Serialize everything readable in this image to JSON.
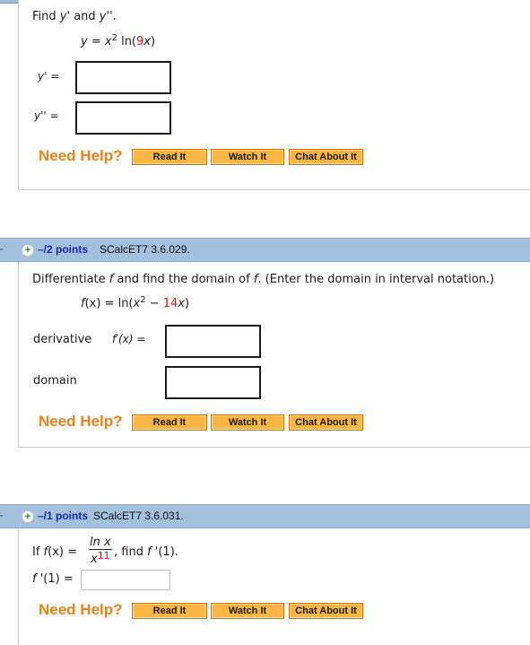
{
  "q1": {
    "prompt_prefix": "Find ",
    "prompt_y1": "y'",
    "prompt_and": " and ",
    "prompt_y2": "y''",
    "prompt_suffix": ".",
    "eq_lhs": "y",
    "eq_eq": " = ",
    "eq_x": "x",
    "eq_exp": "2",
    "eq_ln": " ln(",
    "eq_coef": "9",
    "eq_var": "x",
    "eq_close": ")",
    "label_y1_var": "y'",
    "label_y1_eq": " =",
    "label_y2_var": "y''",
    "label_y2_eq": " =",
    "answer_y1": "",
    "answer_y2": ""
  },
  "q2": {
    "points": "–/2 points",
    "reference": "SCalcET7 3.6.029.",
    "prompt_a": "Differentiate ",
    "prompt_f1": "f",
    "prompt_b": " and find the domain of ",
    "prompt_f2": "f",
    "prompt_c": ". (Enter the domain in interval notation.)",
    "eq_f": "f",
    "eq_paren": "(x)",
    "eq_eq": " = ln(",
    "eq_x": "x",
    "eq_exp": "2",
    "eq_minus": " − ",
    "eq_coef": "14",
    "eq_var": "x",
    "eq_close": ")",
    "label_derivative": "derivative",
    "label_fprime": "f′(x) =",
    "label_domain": "domain",
    "answer_derivative": "",
    "answer_domain": ""
  },
  "q3": {
    "points": "–/1 points",
    "reference": "SCalcET7 3.6.031.",
    "prompt_if": "If  ",
    "prompt_f": "f",
    "prompt_paren": "(x) =",
    "frac_num": "ln x",
    "frac_den_var": "x",
    "frac_den_exp": "11",
    "prompt_find": ", find ",
    "prompt_fp": "f",
    "prompt_fp_rest": " '(1).",
    "label_fp": "f",
    "label_fp_rest": " '(1) =",
    "answer_fp": ""
  },
  "help": {
    "label": "Need Help?",
    "read_it": "Read It",
    "watch_it": "Watch It",
    "chat_about_it": "Chat About It"
  },
  "icons": {
    "expand": "+"
  },
  "colors": {
    "header_band": "#a3c1dd",
    "points_blue": "#1b2aa8",
    "help_orange": "#e8821e",
    "button_orange": "#fcb645",
    "variable_red": "#e01010"
  }
}
